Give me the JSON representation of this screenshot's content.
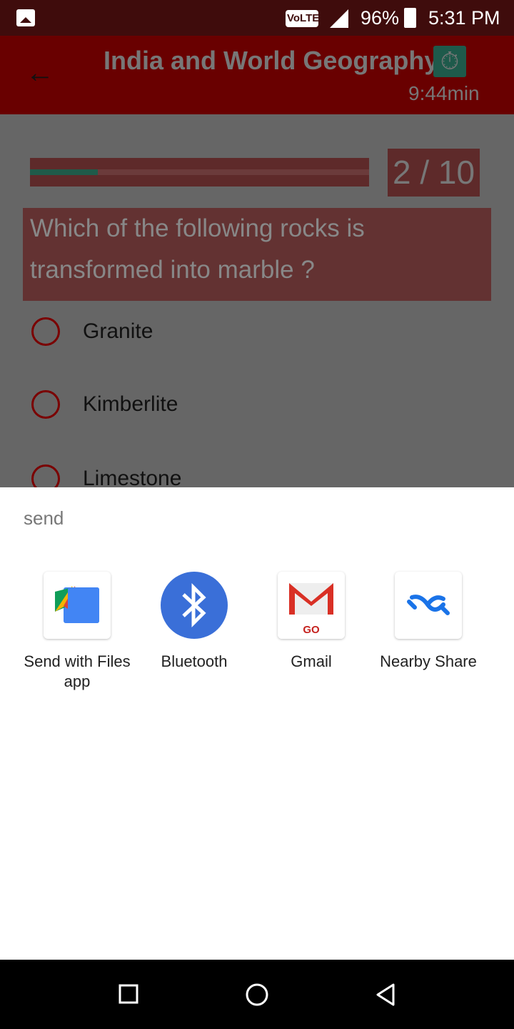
{
  "status_bar": {
    "volte": "VoLTE",
    "battery": "96%",
    "time": "5:31 PM"
  },
  "app_bar": {
    "title": "India and World Geography for Exam",
    "timer": "9:44min"
  },
  "quiz": {
    "progress_fraction": 0.2,
    "counter": "2 / 10",
    "question": "Which of the following rocks is transformed into marble ?",
    "options": [
      "Granite",
      "Kimberlite",
      "Limestone"
    ]
  },
  "share_sheet": {
    "title": "send",
    "targets": [
      {
        "label": "Send with Files app",
        "icon": "files-app-icon"
      },
      {
        "label": "Bluetooth",
        "icon": "bluetooth-icon"
      },
      {
        "label": "Gmail",
        "icon": "gmail-go-icon",
        "badge": "GO"
      },
      {
        "label": "Nearby Share",
        "icon": "nearby-share-icon"
      }
    ]
  },
  "colors": {
    "app_bar": "#690000",
    "accent_green": "#1f5b4a",
    "radio": "#7a0000"
  }
}
